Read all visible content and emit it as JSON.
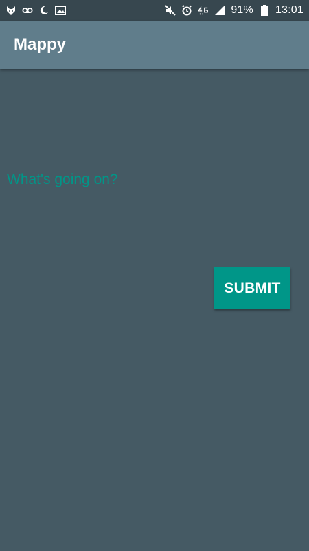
{
  "status_bar": {
    "left_icons": [
      "fox-icon",
      "voicemail-icon",
      "moon-icon",
      "image-icon"
    ],
    "right_icons": [
      "mute-icon",
      "alarm-icon",
      "4g-icon",
      "signal-icon",
      "battery-icon"
    ],
    "battery": "91%",
    "time": "13:01"
  },
  "app_bar": {
    "title": "Mappy",
    "color": "#607d8b"
  },
  "main": {
    "input_placeholder": "What's going on?",
    "submit_label": "SUBMIT",
    "accent_color": "#009688",
    "background_color": "#455a64"
  }
}
